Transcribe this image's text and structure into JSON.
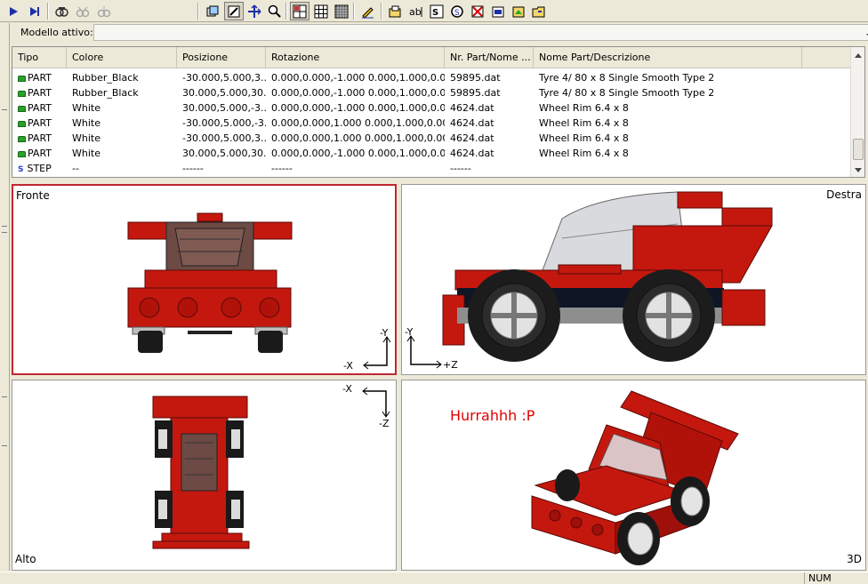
{
  "model": {
    "label": "Modello attivo:",
    "value": ""
  },
  "list": {
    "columns": [
      "Tipo",
      "Colore",
      "Posizione",
      "Rotazione",
      "Nr. Part/Nome ...",
      "Nome Part/Descrizione"
    ],
    "rows": [
      {
        "tipo": "PART",
        "colore": "Rubber_Black",
        "posizione": "-30.000,5.000,3...",
        "rotazione": "0.000,0.000,-1.000 0.000,1.000,0.00...",
        "nr": "59895.dat",
        "nome": "Tyre  4/ 80 x  8 Single Smooth Type 2"
      },
      {
        "tipo": "PART",
        "colore": "Rubber_Black",
        "posizione": "30.000,5.000,30...",
        "rotazione": "0.000,0.000,-1.000 0.000,1.000,0.00...",
        "nr": "59895.dat",
        "nome": "Tyre  4/ 80 x  8 Single Smooth Type 2"
      },
      {
        "tipo": "PART",
        "colore": "White",
        "posizione": "30.000,5.000,-3...",
        "rotazione": "0.000,0.000,-1.000 0.000,1.000,0.00...",
        "nr": "4624.dat",
        "nome": "Wheel Rim  6.4 x  8"
      },
      {
        "tipo": "PART",
        "colore": "White",
        "posizione": "-30.000,5.000,-3...",
        "rotazione": "0.000,0.000,1.000 0.000,1.000,0.000...",
        "nr": "4624.dat",
        "nome": "Wheel Rim  6.4 x  8"
      },
      {
        "tipo": "PART",
        "colore": "White",
        "posizione": "-30.000,5.000,3...",
        "rotazione": "0.000,0.000,1.000 0.000,1.000,0.000...",
        "nr": "4624.dat",
        "nome": "Wheel Rim  6.4 x  8"
      },
      {
        "tipo": "PART",
        "colore": "White",
        "posizione": "30.000,5.000,30...",
        "rotazione": "0.000,0.000,-1.000 0.000,1.000,0.00...",
        "nr": "4624.dat",
        "nome": "Wheel Rim  6.4 x  8"
      },
      {
        "tipo": "STEP",
        "colore": "--",
        "posizione": "------",
        "rotazione": "------",
        "nr": "------",
        "nome": ""
      }
    ]
  },
  "viewports": {
    "front": {
      "label": "Fronte",
      "axis_v": "-Y",
      "axis_h": "-X"
    },
    "right": {
      "label": "Destra",
      "axis_v": "-Y",
      "axis_h": "+Z"
    },
    "top": {
      "label": "Alto",
      "axis_h": "-X",
      "axis_v": "-Z"
    },
    "persp": {
      "label": "3D",
      "annotation": "Hurrahhh :P"
    }
  },
  "status": {
    "num": "NUM"
  },
  "colors": {
    "brick_red": "#c4180f",
    "active_border": "#c0282f",
    "annotation": "#e00000"
  },
  "toolbar_icons": [
    "play-icon",
    "next-step-icon",
    "find-icon",
    "binoculars-icon",
    "binoculars-disabled-icon",
    "wireframe-icon",
    "edit-icon",
    "move-icon",
    "zoom-icon",
    "view-single-icon",
    "view-grid-icon",
    "view-full-icon",
    "pencil-icon",
    "open-icon",
    "ab-icon",
    "replace-icon",
    "color-icon",
    "delete-icon",
    "export-icon",
    "image-icon",
    "folder-icon"
  ]
}
